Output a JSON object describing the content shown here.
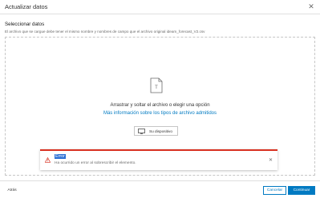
{
  "dialog": {
    "title": "Actualizar datos",
    "close_icon": "close-icon"
  },
  "section": {
    "title": "Seleccionar datos",
    "description": "El archivo que se cargue debe tener el mismo nombre y nombres de campo que el archivo original ideam_forecast_V2.csv"
  },
  "dropzone": {
    "file_icon": "file-icon",
    "main_text": "Arrastrar y soltar el archivo o elegir una opción",
    "link_text": "Más información sobre los tipos de archivo admitidos",
    "device_button": {
      "icon": "monitor-icon",
      "label": "Su dispositivo"
    }
  },
  "error": {
    "icon": "warning-icon",
    "title": "Error",
    "message": "Ha ocurrido un error al sobrescribir el elemento.",
    "close_icon": "close-icon"
  },
  "footer": {
    "back_label": "Atrás",
    "cancel_label": "Cancelar",
    "continue_label": "Continuar"
  },
  "colors": {
    "accent": "#007ac2",
    "error": "#d83020",
    "selection": "#2b6fd4"
  }
}
